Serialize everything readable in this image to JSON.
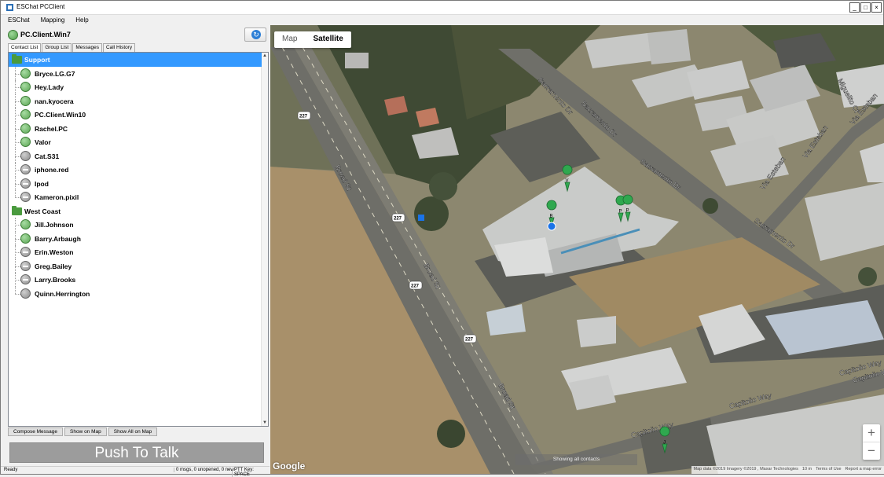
{
  "window": {
    "title": "ESChat PCClient"
  },
  "menu": [
    "ESChat",
    "Mapping",
    "Help"
  ],
  "user": {
    "name": "PC.Client.Win7"
  },
  "tabs": [
    "Contact List",
    "Group List",
    "Messages",
    "Call History"
  ],
  "groups": [
    {
      "name": "Support",
      "contacts": [
        {
          "name": "Bryce.LG.G7",
          "status": "online"
        },
        {
          "name": "Hey.Lady",
          "status": "online"
        },
        {
          "name": "nan.kyocera",
          "status": "online"
        },
        {
          "name": "PC.Client.Win10",
          "status": "online"
        },
        {
          "name": "Rachel.PC",
          "status": "online"
        },
        {
          "name": "Valor",
          "status": "online"
        },
        {
          "name": "Cat.S31",
          "status": "offline"
        },
        {
          "name": "iphone.red",
          "status": "dnd"
        },
        {
          "name": "Ipod",
          "status": "dnd"
        },
        {
          "name": "Kameron.pixil",
          "status": "dnd"
        }
      ]
    },
    {
      "name": "West Coast",
      "contacts": [
        {
          "name": "Jill.Johnson",
          "status": "online"
        },
        {
          "name": "Barry.Arbaugh",
          "status": "online"
        },
        {
          "name": "Erin.Weston",
          "status": "dnd"
        },
        {
          "name": "Greg.Bailey",
          "status": "dnd"
        },
        {
          "name": "Larry.Brooks",
          "status": "dnd"
        },
        {
          "name": "Quinn.Herrington",
          "status": "offline"
        }
      ]
    }
  ],
  "buttons": {
    "compose": "Compose Message",
    "show_on_map": "Show on Map",
    "show_all": "Show All on Map",
    "ptt": "Push To Talk"
  },
  "status": {
    "ready": "Ready",
    "messages": "0 msgs, 0 unopened, 0 new",
    "ptt_key": "PTT Key: SPACE"
  },
  "map": {
    "type_map": "Map",
    "type_satellite": "Satellite",
    "showing": "Showing all contacts",
    "logo": "Google",
    "attribution": [
      "Map data ©2019 Imagery ©2019 , Maxar Technologies",
      "10 m",
      "Terms of Use",
      "Report a map error"
    ],
    "road_labels": [
      "Broad St",
      "Broad St",
      "Broad St",
      "Sacramento Dr",
      "Sacramento Dr",
      "Sacramento Dr",
      "Sacramento Dr",
      "Via Esteban",
      "Via Esteban",
      "Via Esteban",
      "Capitolio Way",
      "Capitolio Way",
      "Capitolio Way",
      "Capitolio Way",
      "Miguelito Ct"
    ],
    "shield_labels": [
      "227",
      "227",
      "227",
      "227"
    ],
    "markers": [
      "V",
      "B",
      "P",
      "P",
      "J"
    ],
    "zoom_in": "+",
    "zoom_out": "−"
  }
}
